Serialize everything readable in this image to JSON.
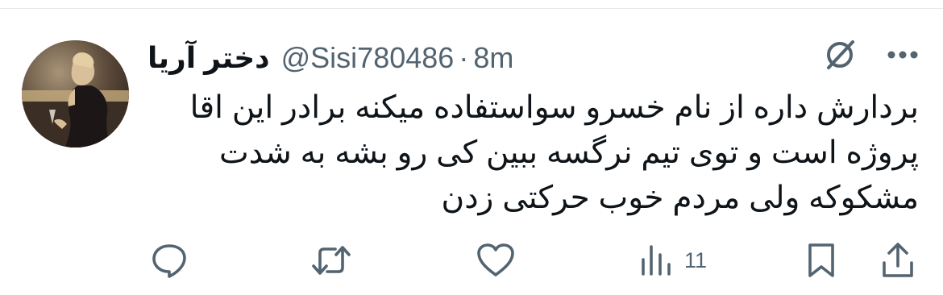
{
  "tweet": {
    "display_name": "دختر آریا",
    "handle": "@Sisi780486",
    "separator": "·",
    "time": "8m",
    "text_lines": [
      "بردارش داره از نام خسرو سواستفاده میکنه برادر این اقا",
      "پروژه است و توی تیم نرگسه ببین کی رو بشه به شدت",
      "مشکوکه ولی مردم خوب حرکتی زدن"
    ]
  },
  "header_icons": [
    "grok-icon",
    "more-icon"
  ],
  "actions": {
    "reply": {
      "icon": "reply-icon"
    },
    "retweet": {
      "icon": "retweet-icon"
    },
    "like": {
      "icon": "heart-icon"
    },
    "views": {
      "icon": "views-icon",
      "count": "11"
    },
    "bookmark": {
      "icon": "bookmark-icon"
    },
    "share": {
      "icon": "share-icon"
    }
  },
  "colors": {
    "text_primary": "#0f1419",
    "text_secondary": "#536471",
    "divider": "#e6e9ec"
  }
}
